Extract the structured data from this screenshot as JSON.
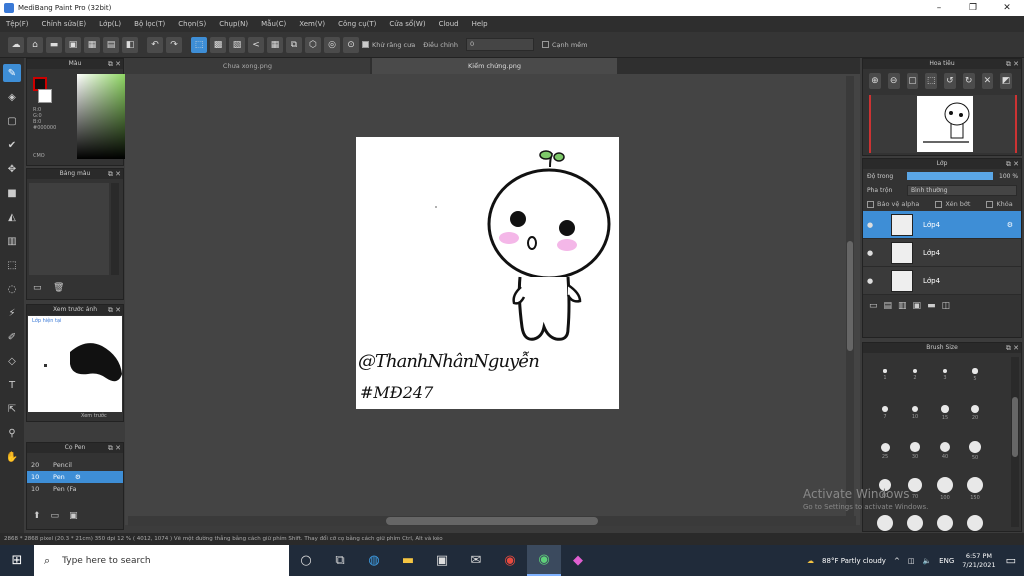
{
  "window": {
    "title": "MediBang Paint Pro (32bit)",
    "min": "–",
    "max": "❐",
    "close": "✕"
  },
  "menu": [
    "Tệp(F)",
    "Chỉnh sửa(E)",
    "Lớp(L)",
    "Bộ lọc(T)",
    "Chọn(S)",
    "Chụp(N)",
    "Mẫu(C)",
    "Xem(V)",
    "Công cụ(T)",
    "Cửa sổ(W)",
    "Cloud",
    "Help"
  ],
  "toolbar": {
    "check_label": "Khử răng cưa",
    "correction_label": "Điều chỉnh",
    "correction_value": "0",
    "edge_label": "Cạnh mềm"
  },
  "tabs": [
    {
      "label": "Chưa xong.png"
    },
    {
      "label": "Kiểm chứng.png"
    }
  ],
  "color_panel": {
    "title": "Màu",
    "values": "R:0\nG:0\nB:0\n#000000",
    "readout": "CMO"
  },
  "palette_panel": {
    "title": "Bảng màu"
  },
  "preview_panel": {
    "title": "Xem trước ảnh",
    "tab1": "Lớp hiện tại",
    "tab2": "Xem trước"
  },
  "pen_panel": {
    "title": "Cọ Pen",
    "items": [
      {
        "size": "20",
        "name": "Pencil"
      },
      {
        "size": "10",
        "name": "Pen"
      },
      {
        "size": "10",
        "name": "Pen (Fa"
      }
    ]
  },
  "navigator_panel": {
    "title": "Hoa tiêu"
  },
  "layer_panel": {
    "title": "Lớp",
    "opacity_label": "Độ trong",
    "opacity_value": "100 %",
    "opacity_fraction": 1.0,
    "blend_label": "Pha trộn",
    "blend_value": "Bình thường",
    "opt_protect": "Bảo vệ alpha",
    "opt_clip": "Xén bớt",
    "opt_lock": "Khóa",
    "layers": [
      {
        "name": "Lớp4"
      },
      {
        "name": "Lớp4"
      },
      {
        "name": "Lớp4"
      }
    ]
  },
  "brush_size_panel": {
    "title": "Brush Size",
    "sizes": [
      "1",
      "2",
      "3",
      "5",
      "7",
      "10",
      "15",
      "20",
      "25",
      "30",
      "40",
      "50",
      "60",
      "70",
      "100",
      "150",
      "200",
      "250",
      "300",
      "350"
    ]
  },
  "status": {
    "text": "2868 * 2868 pixel  (20.3 * 21cm)  350 dpi  12 %  ( 4012, 1074 )  Vẽ một đường thẳng bằng cách giữ phím Shift. Thay đổi cỡ cọ bằng cách giữ phím Ctrl, Alt và kéo"
  },
  "artwork": {
    "signature_line1": "@ThanhNhânNguyễn",
    "signature_line2": "#MĐ247"
  },
  "watermark": {
    "line1": "Activate Windows",
    "line2": "Go to Settings to activate Windows."
  },
  "taskbar": {
    "search_placeholder": "Type here to search",
    "weather": "88°F  Partly cloudy",
    "lang": "ENG",
    "time": "6:57 PM",
    "date": "7/21/2021"
  }
}
